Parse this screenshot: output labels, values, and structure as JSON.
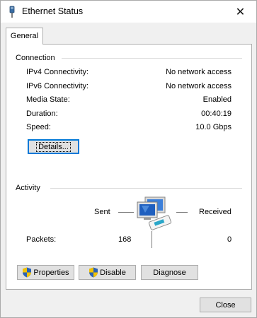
{
  "window": {
    "title": "Ethernet Status"
  },
  "tabs": [
    {
      "label": "General"
    }
  ],
  "connection": {
    "group_title": "Connection",
    "rows": [
      {
        "label": "IPv4 Connectivity:",
        "value": "No network access"
      },
      {
        "label": "IPv6 Connectivity:",
        "value": "No network access"
      },
      {
        "label": "Media State:",
        "value": "Enabled"
      },
      {
        "label": "Duration:",
        "value": "00:40:19"
      },
      {
        "label": "Speed:",
        "value": "10.0 Gbps"
      }
    ],
    "details_button": "Details..."
  },
  "activity": {
    "group_title": "Activity",
    "sent_label": "Sent",
    "received_label": "Received",
    "packets_label": "Packets:",
    "packets_sent": "168",
    "packets_received": "0"
  },
  "buttons": {
    "properties": "Properties",
    "disable": "Disable",
    "diagnose": "Diagnose",
    "close": "Close"
  },
  "icons": {
    "title": "network-adapter-icon",
    "activity": "network-computers-icon",
    "shield": "uac-shield-icon"
  }
}
